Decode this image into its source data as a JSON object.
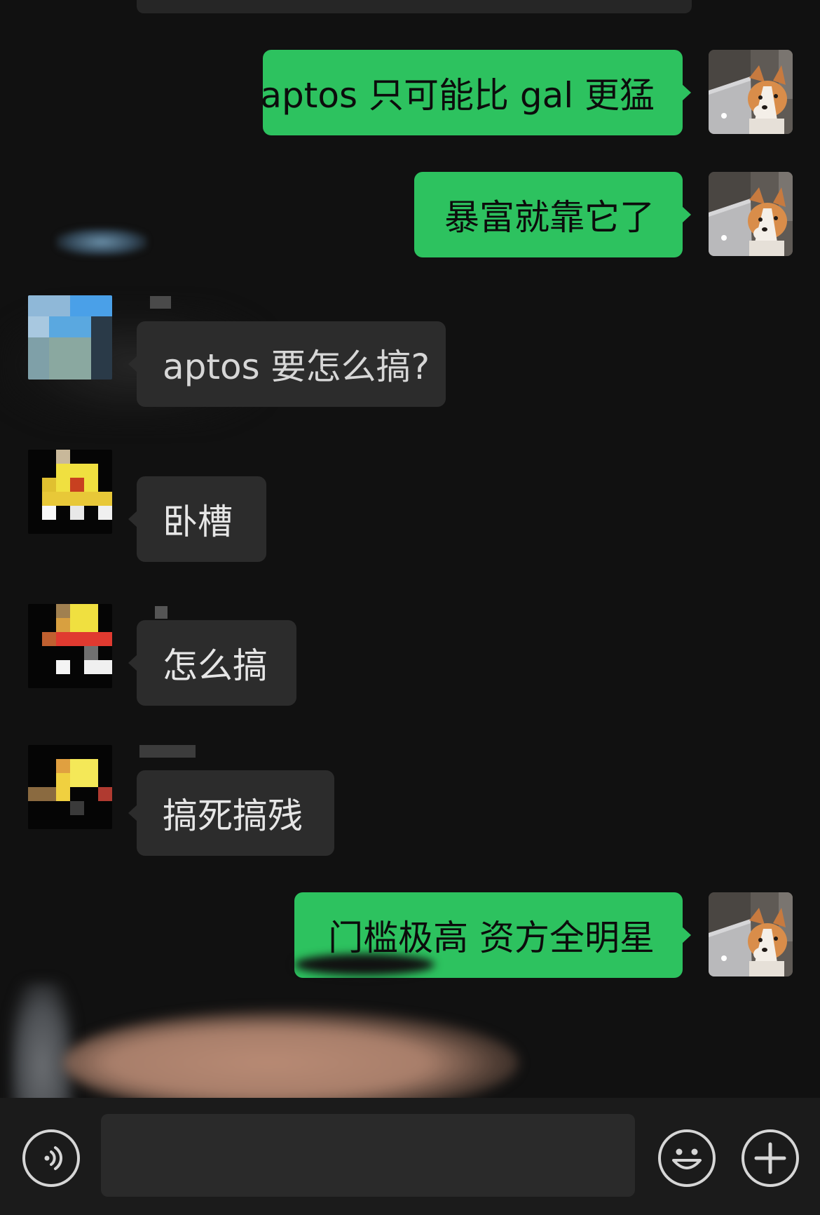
{
  "messages": [
    {
      "side": "me",
      "text": "aptos 只可能比 gal 更猛"
    },
    {
      "side": "me",
      "text": "暴富就靠它了"
    },
    {
      "side": "other",
      "text": "aptos 要怎么搞?"
    },
    {
      "side": "other",
      "text": "卧槽"
    },
    {
      "side": "other",
      "text": "怎么搞"
    },
    {
      "side": "other",
      "text": "搞死搞残"
    },
    {
      "side": "me",
      "text": "门槛极高 资方全明星"
    }
  ],
  "input": {
    "placeholder": ""
  },
  "icons": {
    "voice": "voice-icon",
    "emoji": "emoji-icon",
    "plus": "plus-icon"
  },
  "colors": {
    "background": "#111111",
    "my_bubble": "#2dc25f",
    "other_bubble": "#2c2c2c",
    "bottom_bar": "#1b1b1b"
  }
}
